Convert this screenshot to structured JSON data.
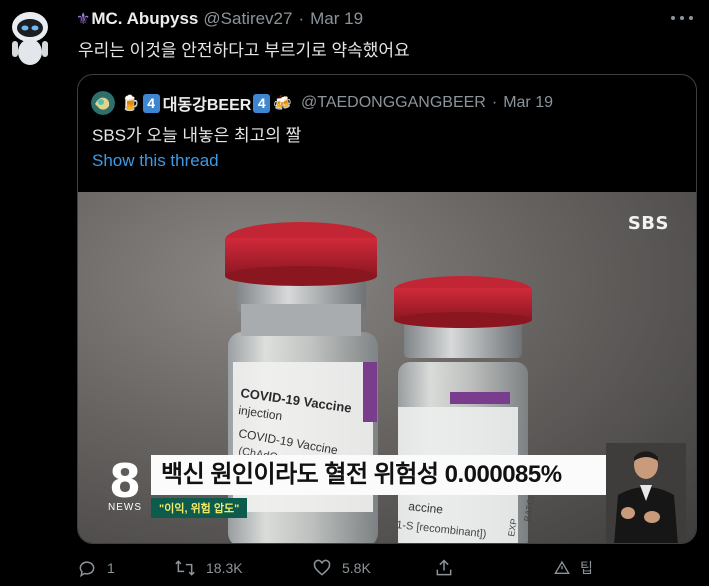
{
  "tweet": {
    "display_name": "MC. Abupyss",
    "handle": "@Satirev27",
    "separator": "·",
    "date": "Mar 19",
    "text": "우리는 이것을 안전하다고 부르기로 약속했어요"
  },
  "quoted_tweet": {
    "emoji_before": "🍺",
    "badge_left": "4",
    "display_name": "대동강BEER",
    "badge_right": "4",
    "emoji_after": "🍻",
    "handle": "@TAEDONGGANGBEER",
    "separator": "·",
    "date": "Mar 19",
    "text": "SBS가 오늘 내놓은 최고의 짤",
    "show_thread": "Show this thread"
  },
  "media": {
    "broadcaster_logo": "SBS",
    "channel_number": "8",
    "channel_label": "NEWS",
    "headline_caption": "백신 원인이라도 혈전 위험성 0.000085%",
    "sub_caption": "\"이익, 위험 압도\"",
    "vial_left_labels": [
      "COVID-19 Vaccine",
      "injection",
      "COVID-19 Vaccine",
      "(ChAdOx1-S [recombinant])"
    ],
    "vial_right_labels": [
      "accine",
      "1-S [recombinant])",
      "BATCH",
      "EXP"
    ]
  },
  "actions": {
    "reply_count": "1",
    "retweet_count": "18.3K",
    "like_count": "5.8K",
    "tip_label": "팁"
  },
  "colors": {
    "background": "#000000",
    "link": "#3d9ae6",
    "secondary_text": "#8b949b",
    "badge": "#3f86d1",
    "vial_cap": "#b6202e",
    "caption_banner": "#fbfbfb",
    "sub_caption_bg": "#0d5b4c"
  }
}
